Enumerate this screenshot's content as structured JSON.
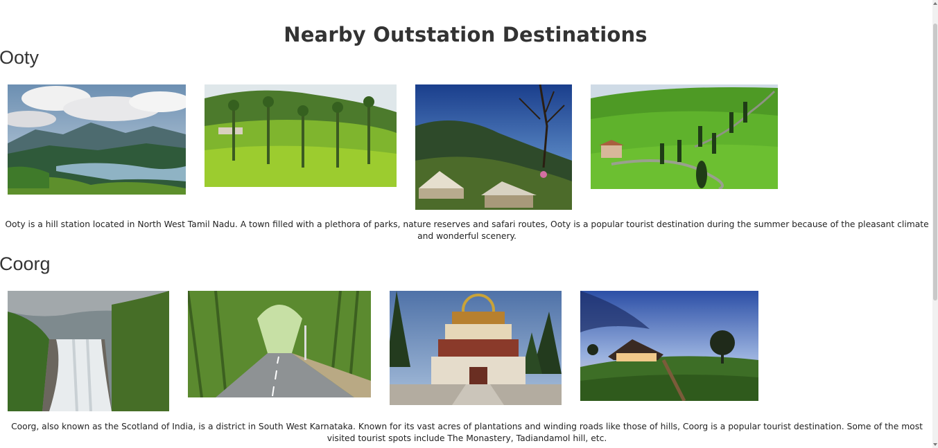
{
  "page": {
    "title": "Nearby Outstation Destinations"
  },
  "sections": [
    {
      "heading": "Ooty",
      "images": [
        {
          "alt": "Ooty lake and mountains"
        },
        {
          "alt": "Ooty tea plantation"
        },
        {
          "alt": "Ooty forest tents"
        },
        {
          "alt": "Ooty green hills road"
        }
      ],
      "description": "Ooty is a hill station located in North West Tamil Nadu. A town filled with a plethora of parks, nature reserves and safari routes, Ooty is a popular tourist destination during the summer because of the pleasant climate and wonderful scenery."
    },
    {
      "heading": "Coorg",
      "images": [
        {
          "alt": "Coorg waterfall"
        },
        {
          "alt": "Coorg bamboo road"
        },
        {
          "alt": "Coorg monastery"
        },
        {
          "alt": "Coorg hill house"
        }
      ],
      "description": "Coorg, also known as the Scotland of India, is a district in South West Karnataka. Known for its vast acres of plantations and winding roads like those of hills, Coorg is a popular tourist destination. Some of the most visited tourist spots include The Monastery, Tadiandamol hill, etc."
    }
  ]
}
